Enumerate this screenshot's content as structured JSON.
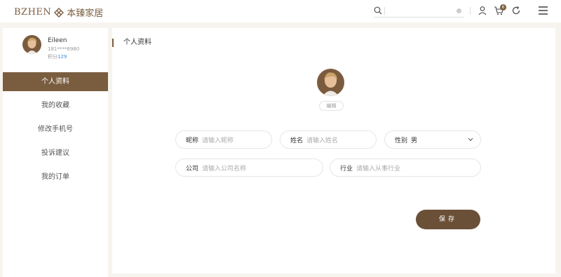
{
  "header": {
    "logo_latin": "BZHEN",
    "logo_cn": "本臻家居",
    "search_placeholder": "",
    "cart_count": "6",
    "icons": [
      "search-icon",
      "clear-icon",
      "user-icon",
      "cart-icon",
      "refresh-icon",
      "menu-icon"
    ],
    "brand_color": "#7a5d3f"
  },
  "sidebar": {
    "user_name": "Eileen",
    "user_phone": "181****6980",
    "points_label": "积分",
    "points_value": "129",
    "items": [
      {
        "label": "个人资料",
        "active": true
      },
      {
        "label": "我的收藏",
        "active": false
      },
      {
        "label": "修改手机号",
        "active": false
      },
      {
        "label": "投诉建议",
        "active": false
      },
      {
        "label": "我的订单",
        "active": false
      }
    ]
  },
  "main": {
    "title": "个人资料",
    "edit_label": "编辑",
    "fields": {
      "nickname": {
        "label": "昵称",
        "placeholder": "请输入昵称"
      },
      "name": {
        "label": "姓名",
        "placeholder": "请输入姓名"
      },
      "gender": {
        "label": "性别",
        "value": "男"
      },
      "company": {
        "label": "公司",
        "placeholder": "请输入公司名称"
      },
      "industry": {
        "label": "行业",
        "placeholder": "请输入从事行业"
      }
    },
    "save_label": "保存",
    "save_color": "#6b5038"
  }
}
